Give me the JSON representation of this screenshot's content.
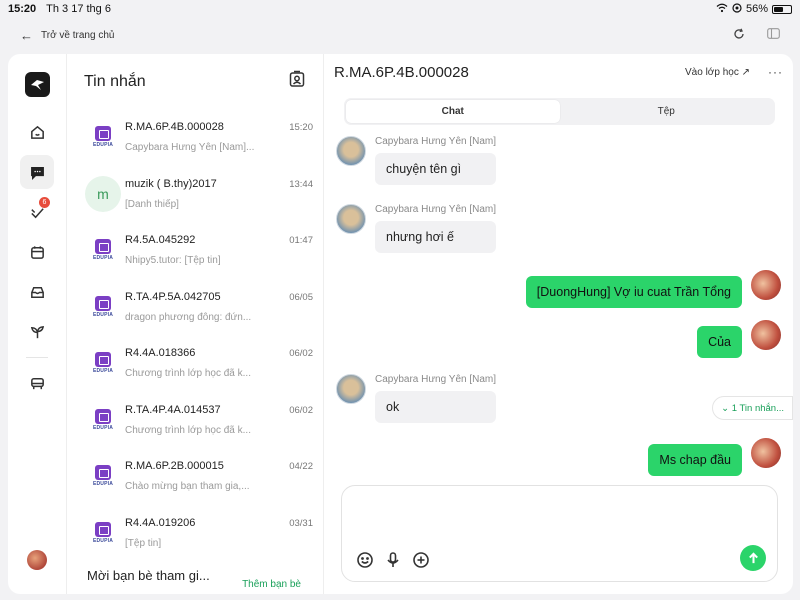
{
  "status": {
    "time": "15:20",
    "date": "Th 3 17 thg 6",
    "battery": "56%",
    "battery_fraction": 0.56
  },
  "topnav": {
    "back_label": "Trở về trang chủ"
  },
  "rail": {
    "badge_count": "6"
  },
  "list": {
    "title": "Tin nhắn",
    "items": [
      {
        "name": "R.MA.6P.4B.000028",
        "time": "15:20",
        "preview": "Capybara Hưng Yên [Nam]...",
        "avatar": "edupia"
      },
      {
        "name": "muzik ( B.thy)2017",
        "time": "13:44",
        "preview": "[Danh thiếp]",
        "avatar": "m"
      },
      {
        "name": "R4.5A.045292",
        "time": "01:47",
        "preview": "Nhipy5.tutor: [Tệp tin]",
        "avatar": "edupia"
      },
      {
        "name": "R.TA.4P.5A.042705",
        "time": "06/05",
        "preview": "dragon phương đông: đứn...",
        "avatar": "edupia"
      },
      {
        "name": "R4.4A.018366",
        "time": "06/02",
        "preview": "Chương trình lớp học đã k...",
        "avatar": "edupia"
      },
      {
        "name": "R.TA.4P.4A.014537",
        "time": "06/02",
        "preview": "Chương trình lớp học đã k...",
        "avatar": "edupia"
      },
      {
        "name": "R.MA.6P.2B.000015",
        "time": "04/22",
        "preview": "Chào mừng bạn tham gia,...",
        "avatar": "edupia"
      },
      {
        "name": "R4.4A.019206",
        "time": "03/31",
        "preview": "[Tệp tin]",
        "avatar": "edupia"
      }
    ],
    "edupia_text": "EDUPIA",
    "invite_title": "Mời bạn bè tham gi...",
    "invite_link": "Thêm bạn bè"
  },
  "chat": {
    "title": "R.MA.6P.4B.000028",
    "join_label": "Vào lớp học ↗",
    "tabs": [
      "Chat",
      "Tệp"
    ],
    "messages": [
      {
        "sender": "Capybara Hưng Yên [Nam]",
        "text": "chuyện tên gì",
        "mine": false
      },
      {
        "sender": "Capybara Hưng Yên [Nam]",
        "text": "nhưng hơi ế",
        "mine": false
      },
      {
        "sender": "",
        "text": "[DuongHung] Vợ iu cuat Trần Tổng",
        "mine": true
      },
      {
        "sender": "",
        "text": "Của",
        "mine": true
      },
      {
        "sender": "Capybara Hưng Yên [Nam]",
        "text": "ok",
        "mine": false
      },
      {
        "sender": "",
        "text": "Ms chap đầu",
        "mine": true
      }
    ],
    "new_messages": "⌄ 1 Tin nhắn..."
  }
}
